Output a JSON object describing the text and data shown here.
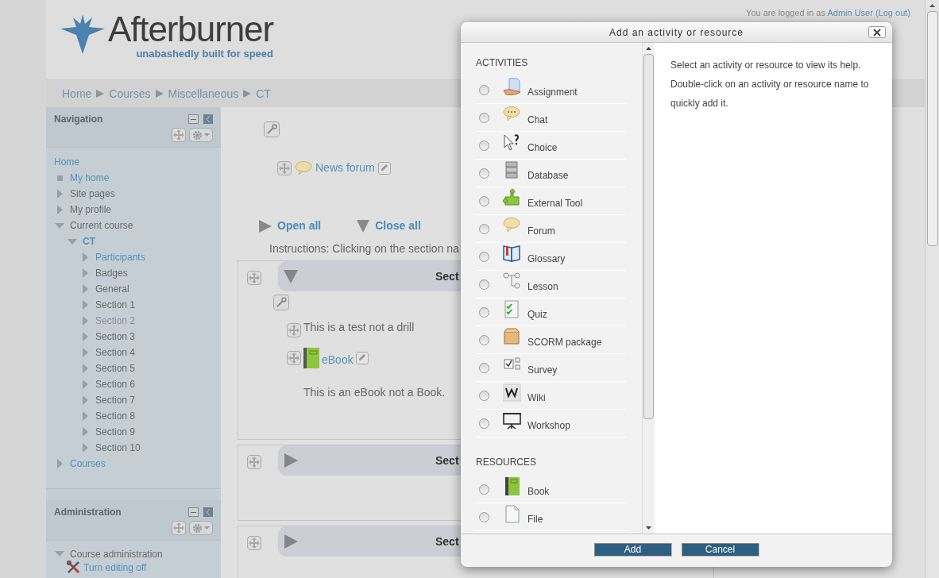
{
  "header": {
    "logo_title": "Afterburner",
    "logo_tagline": "unabashedly built for speed",
    "login_text": "You are logged in as",
    "login_user": "Admin User",
    "logout": "(Log out)"
  },
  "breadcrumb": [
    "Home",
    "Courses",
    "Miscellaneous",
    "CT"
  ],
  "navigation": {
    "title": "Navigation",
    "items": [
      {
        "label": "Home",
        "kind": "link",
        "children": [
          {
            "label": "My home",
            "kind": "link"
          },
          {
            "label": "Site pages",
            "kind": "plain",
            "expanded": false
          },
          {
            "label": "My profile",
            "kind": "plain",
            "expanded": false
          },
          {
            "label": "Current course",
            "kind": "plain",
            "expanded": true,
            "children": [
              {
                "label": "CT",
                "kind": "link",
                "expanded": true,
                "children": [
                  {
                    "label": "Participants",
                    "kind": "link",
                    "expanded": false
                  },
                  {
                    "label": "Badges",
                    "kind": "plain",
                    "expanded": false
                  },
                  {
                    "label": "General",
                    "kind": "plain",
                    "expanded": false
                  },
                  {
                    "label": "Section 1",
                    "kind": "plain",
                    "expanded": false
                  },
                  {
                    "label": "Section 2",
                    "kind": "dimmed",
                    "expanded": false
                  },
                  {
                    "label": "Section 3",
                    "kind": "plain",
                    "expanded": false
                  },
                  {
                    "label": "Section 4",
                    "kind": "plain",
                    "expanded": false
                  },
                  {
                    "label": "Section 5",
                    "kind": "plain",
                    "expanded": false
                  },
                  {
                    "label": "Section 6",
                    "kind": "plain",
                    "expanded": false
                  },
                  {
                    "label": "Section 7",
                    "kind": "plain",
                    "expanded": false
                  },
                  {
                    "label": "Section 8",
                    "kind": "plain",
                    "expanded": false
                  },
                  {
                    "label": "Section 9",
                    "kind": "plain",
                    "expanded": false
                  },
                  {
                    "label": "Section 10",
                    "kind": "plain",
                    "expanded": false
                  }
                ]
              }
            ]
          },
          {
            "label": "Courses",
            "kind": "link",
            "expanded": false
          }
        ]
      }
    ]
  },
  "administration": {
    "title": "Administration",
    "items": [
      {
        "label": "Course administration",
        "kind": "plain",
        "expanded": true,
        "children": [
          {
            "label": "Turn editing off",
            "kind": "tool"
          }
        ]
      }
    ]
  },
  "course": {
    "news_forum": "News forum",
    "open_all": "Open all",
    "close_all": "Close all",
    "instructions": "Instructions: Clicking on the section na",
    "sections": [
      {
        "heading": "Sect",
        "expanded": true,
        "items": [
          {
            "kind": "label",
            "text": "This is a test not a drill"
          },
          {
            "kind": "book",
            "text": "eBook"
          },
          {
            "kind": "description",
            "text": "This is an eBook not a Book."
          }
        ]
      },
      {
        "heading": "Sect",
        "expanded": false
      },
      {
        "heading": "Sect",
        "expanded": false
      }
    ]
  },
  "dialog": {
    "title": "Add an activity or resource",
    "groups": [
      {
        "heading": "ACTIVITIES",
        "items": [
          {
            "label": "Assignment",
            "selected": false
          },
          {
            "label": "Chat",
            "selected": false
          },
          {
            "label": "Choice",
            "selected": false
          },
          {
            "label": "Database",
            "selected": false
          },
          {
            "label": "External Tool",
            "selected": false
          },
          {
            "label": "Forum",
            "selected": false
          },
          {
            "label": "Glossary",
            "selected": false
          },
          {
            "label": "Lesson",
            "selected": false
          },
          {
            "label": "Quiz",
            "selected": false
          },
          {
            "label": "SCORM package",
            "selected": false
          },
          {
            "label": "Survey",
            "selected": false
          },
          {
            "label": "Wiki",
            "selected": false
          },
          {
            "label": "Workshop",
            "selected": false
          }
        ]
      },
      {
        "heading": "RESOURCES",
        "items": [
          {
            "label": "Book",
            "selected": false
          },
          {
            "label": "File",
            "selected": false
          }
        ]
      }
    ],
    "help": [
      "Select an activity or resource to view its help.",
      "Double-click on an activity or resource name to quickly add it."
    ],
    "buttons": [
      "Add",
      "Cancel"
    ]
  }
}
